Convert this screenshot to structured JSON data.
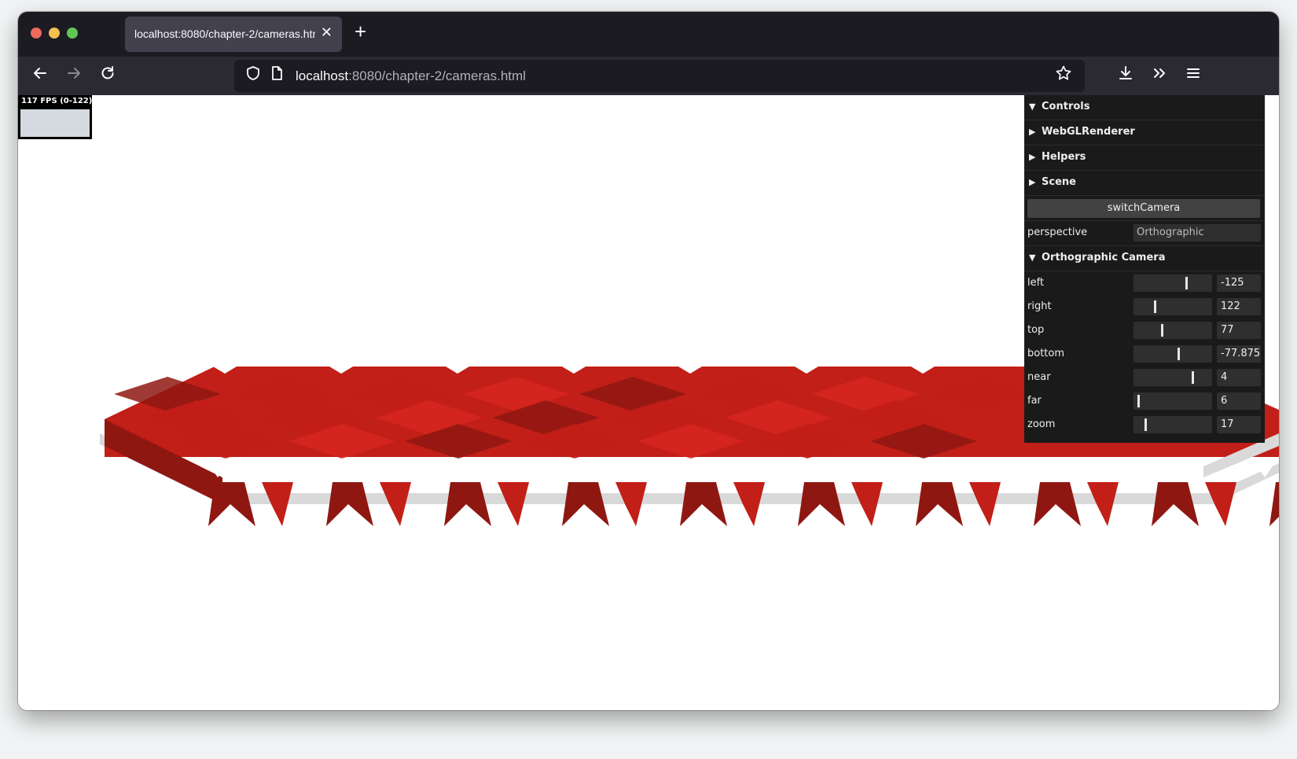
{
  "browser": {
    "tab_title": "localhost:8080/chapter-2/cameras.html",
    "tab_close_icon": "close-icon",
    "new_tab_icon": "plus-icon",
    "url_host": "localhost",
    "url_path": ":8080/chapter-2/cameras.html",
    "icons": [
      "back-arrow-icon",
      "forward-arrow-icon",
      "reload-icon",
      "shield-icon",
      "page-icon",
      "star-icon",
      "download-icon",
      "chevrons-right-icon",
      "hamburger-menu-icon"
    ]
  },
  "stats": {
    "label": "117 FPS (0-122)"
  },
  "gui": {
    "folders": {
      "controls": "Controls",
      "webgl": "WebGLRenderer",
      "helpers": "Helpers",
      "scene": "Scene",
      "ortho": "Orthographic Camera"
    },
    "switch_button": "switchCamera",
    "perspective": {
      "label": "perspective",
      "value": "Orthographic"
    },
    "params": [
      {
        "label": "left",
        "value": "-125",
        "level": 0.68
      },
      {
        "label": "right",
        "value": "122",
        "level": 0.27
      },
      {
        "label": "top",
        "value": "77",
        "level": 0.36
      },
      {
        "label": "bottom",
        "value": "-77.875",
        "level": 0.58
      },
      {
        "label": "near",
        "value": "4",
        "level": 0.76
      },
      {
        "label": "far",
        "value": "6",
        "level": 0.05
      },
      {
        "label": "zoom",
        "value": "17",
        "level": 0.14
      }
    ]
  },
  "colors": {
    "cube_light": "#d6261f",
    "cube_mid": "#c21f18",
    "cube_dark": "#8f1712",
    "plane": "#d9d9d9",
    "gui_bg": "#1a1a1a"
  }
}
